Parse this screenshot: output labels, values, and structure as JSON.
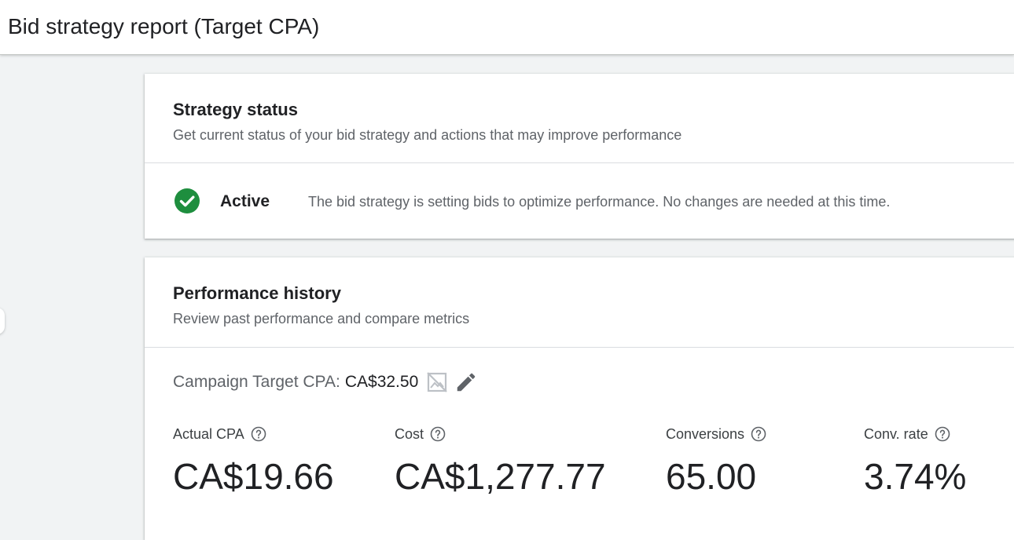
{
  "page": {
    "title": "Bid strategy report (Target CPA)"
  },
  "strategy_status": {
    "title": "Strategy status",
    "subtitle": "Get current status of your bid strategy and actions that may improve performance",
    "status_label": "Active",
    "status_message": "The bid strategy is setting bids to optimize performance. No changes are needed at this time.",
    "status_icon": "check-circle-icon",
    "status_color": "#1e8e3e"
  },
  "performance_history": {
    "title": "Performance history",
    "subtitle": "Review past performance and compare metrics",
    "target_label": "Campaign Target CPA:",
    "target_value": "CA$32.50",
    "metrics": [
      {
        "label": "Actual CPA",
        "value": "CA$19.66"
      },
      {
        "label": "Cost",
        "value": "CA$1,277.77"
      },
      {
        "label": "Conversions",
        "value": "65.00"
      },
      {
        "label": "Conv. rate",
        "value": "3.74%"
      }
    ]
  }
}
